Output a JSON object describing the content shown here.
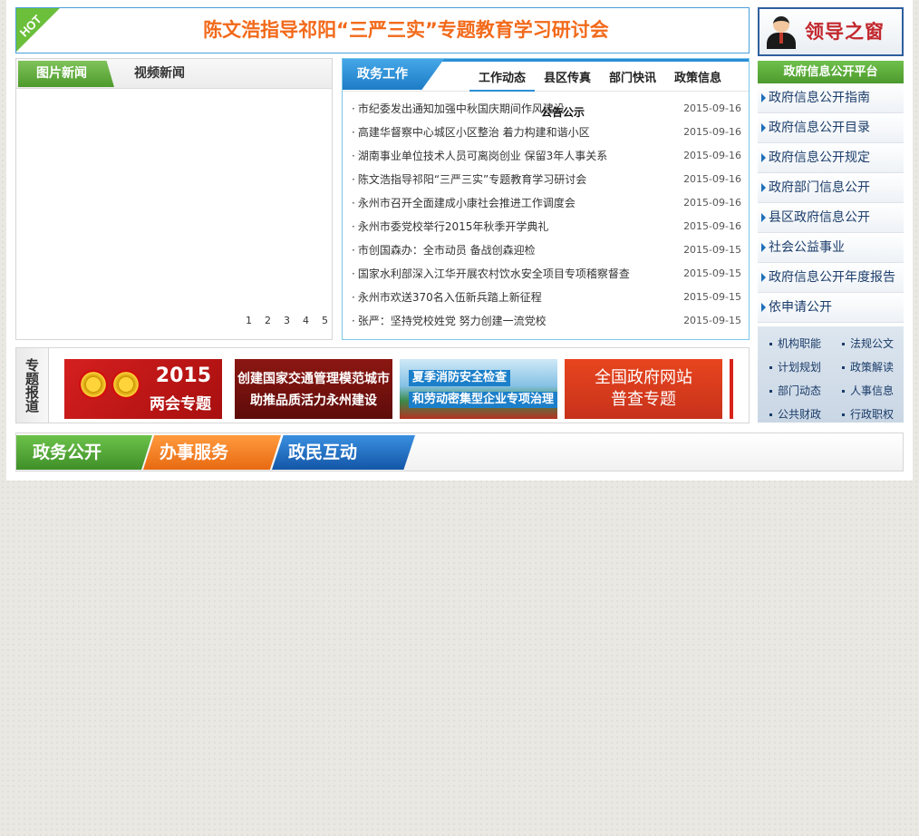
{
  "hot_banner": {
    "ribbon": "HOT",
    "title": "陈文浩指导祁阳“三严三实”专题教育学习研讨会"
  },
  "leader_window": {
    "title": "领导之窗"
  },
  "picture_news": {
    "tabs": [
      "图片新闻",
      "视频新闻"
    ],
    "pages": [
      "1",
      "2",
      "3",
      "4",
      "5"
    ]
  },
  "gov_work": {
    "title": "政务工作",
    "tabs": [
      "工作动态",
      "县区传真",
      "部门快讯",
      "政策信息"
    ],
    "overlay": "公告公示",
    "news": [
      {
        "title": "市纪委发出通知加强中秋国庆期间作风建设",
        "date": "2015-09-16"
      },
      {
        "title": "高建华督察中心城区小区整治 着力构建和谐小区",
        "date": "2015-09-16"
      },
      {
        "title": "湖南事业单位技术人员可离岗创业 保留3年人事关系",
        "date": "2015-09-16"
      },
      {
        "title": "陈文浩指导祁阳“三严三实”专题教育学习研讨会",
        "date": "2015-09-16"
      },
      {
        "title": "永州市召开全面建成小康社会推进工作调度会",
        "date": "2015-09-16"
      },
      {
        "title": "永州市委党校举行2015年秋季开学典礼",
        "date": "2015-09-16"
      },
      {
        "title": "市创国森办：全市动员 备战创森迎检",
        "date": "2015-09-15"
      },
      {
        "title": "国家水利部深入江华开展农村饮水安全项目专项稽察督查",
        "date": "2015-09-15"
      },
      {
        "title": "永州市欢送370名入伍新兵踏上新征程",
        "date": "2015-09-15"
      },
      {
        "title": "张严：坚持党校姓党  努力创建一流党校",
        "date": "2015-09-15"
      }
    ]
  },
  "info_platform": {
    "title": "政府信息公开平台",
    "items": [
      "政府信息公开指南",
      "政府信息公开目录",
      "政府信息公开规定",
      "政府部门信息公开",
      "县区政府信息公开",
      "社会公益事业",
      "政府信息公开年度报告",
      "依申请公开"
    ]
  },
  "quick_links": [
    "机构职能",
    "法规公文",
    "计划规划",
    "政策解读",
    "部门动态",
    "人事信息",
    "公共财政",
    "行政职权"
  ],
  "topics": {
    "label": "专题报道",
    "banner1": {
      "year": "2015",
      "text": "两会专题"
    },
    "banner2": {
      "line1": "创建国家交通管理模范城市",
      "line2": "助推品质活力永州建设"
    },
    "banner3": {
      "line1": "夏季消防安全检查",
      "line2": "和劳动密集型企业专项治理"
    },
    "banner4": {
      "line1": "全国政府网站",
      "line2": "普查专题"
    }
  },
  "service_tabs": [
    "政务公开",
    "办事服务",
    "政民互动"
  ],
  "colors": {
    "accent_green": "#4e9a2c",
    "accent_blue": "#2b8fd6",
    "headline_orange": "#f26a1b",
    "leader_red": "#c2282e"
  }
}
